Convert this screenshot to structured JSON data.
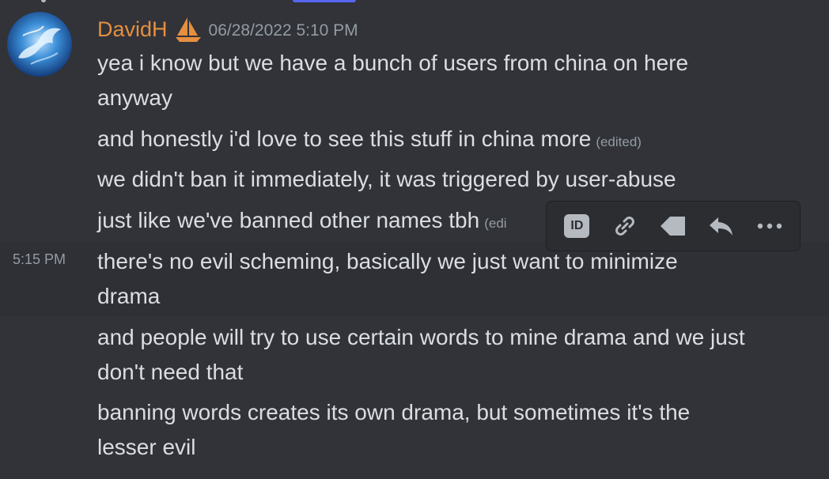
{
  "colors": {
    "background": "#313338",
    "username": "#e58f3f",
    "text": "#dbdee1",
    "muted": "#949ba4"
  },
  "message_group": {
    "author": "DavidH",
    "author_badge_icon": "sailboat-icon",
    "timestamp": "06/28/2022 5:10 PM",
    "edited_label": "(edited)",
    "edited_label_truncated": "(edi",
    "hover_side_time": "5:15 PM",
    "messages": [
      {
        "text": "yea i know but we have a bunch of users from china on here anyway"
      },
      {
        "text": "and honestly i'd love to see this stuff in china more"
      },
      {
        "text": "we didn't ban it immediately, it was triggered by user-abuse"
      },
      {
        "text": "just like we've banned other names tbh"
      },
      {
        "text": "there's no evil scheming, basically we just want to minimize drama"
      },
      {
        "text": "and people will try to use certain words to mine drama and we just don't need that"
      },
      {
        "text": "banning words creates its own drama, but sometimes it's the lesser evil"
      }
    ]
  },
  "toolbar": {
    "id_label": "ID",
    "items": [
      "copy-id-icon",
      "link-icon",
      "tag-icon",
      "reply-icon",
      "more-icon"
    ]
  }
}
